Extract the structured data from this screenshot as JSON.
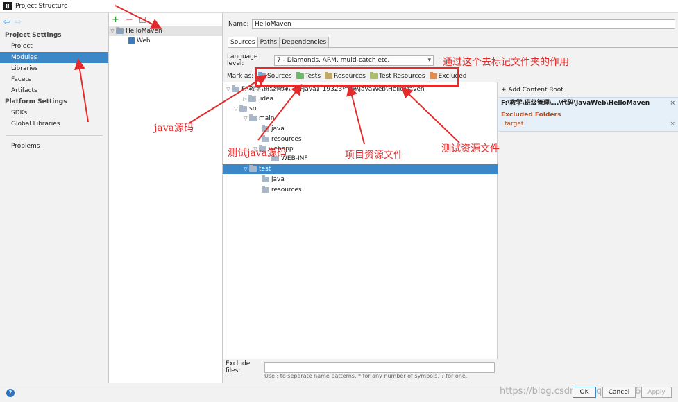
{
  "window": {
    "title": "Project Structure",
    "app_icon": "IJ"
  },
  "left_nav": {
    "back_icon": "arrow-left-icon",
    "forward_icon": "arrow-right-icon",
    "project_settings_header": "Project Settings",
    "project_settings_items": [
      "Project",
      "Modules",
      "Libraries",
      "Facets",
      "Artifacts"
    ],
    "platform_settings_header": "Platform Settings",
    "platform_settings_items": [
      "SDKs",
      "Global Libraries"
    ],
    "problems": "Problems",
    "selected": "Modules"
  },
  "module_tree": {
    "add": "+",
    "remove": "−",
    "module_name": "HelloMaven",
    "facet_name": "Web"
  },
  "module_details": {
    "name_label": "Name:",
    "name_value": "HelloMaven",
    "tabs": [
      "Sources",
      "Paths",
      "Dependencies"
    ],
    "active_tab": "Sources",
    "language_level_label": "Language level:",
    "language_level_value": "7 - Diamonds, ARM, multi-catch etc.",
    "mark_as_label": "Mark as:",
    "mark_as_buttons": [
      "Sources",
      "Tests",
      "Resources",
      "Test Resources",
      "Excluded"
    ]
  },
  "file_tree": {
    "root": "F:\\教学\\班级管理\\【开Java】19323\\代码\\JavaWeb\\HelloMaven",
    "idea": ".idea",
    "src": "src",
    "main": "main",
    "main_java": "java",
    "main_resources": "resources",
    "webapp": "webapp",
    "web_inf": "WEB-INF",
    "test": "test",
    "test_java": "java",
    "test_resources": "resources"
  },
  "content_roots": {
    "add_label": "+ Add Content Root",
    "root_path": "F:\\教学\\班级管理\\...\\代码\\JavaWeb\\HelloMaven",
    "excluded_header": "Excluded Folders",
    "excluded_item": "target",
    "close": "×"
  },
  "exclude_files": {
    "label": "Exclude files:",
    "value": "",
    "hint": "Use ; to separate name patterns, * for any number of symbols, ? for one."
  },
  "buttons": {
    "help": "?",
    "ok": "OK",
    "cancel": "Cancel",
    "apply": "Apply"
  },
  "watermark": "https://blog.csdn.net/qq_41616629",
  "annotations": {
    "mark_usage": "通过这个去标记文件夹的作用",
    "java_source": "java源码",
    "test_java_source": "测试java源码",
    "project_resources": "项目资源文件",
    "test_resources": "测试资源文件"
  },
  "colors": {
    "accent": "#3c87c8",
    "annotation_red": "#e32b2b"
  }
}
